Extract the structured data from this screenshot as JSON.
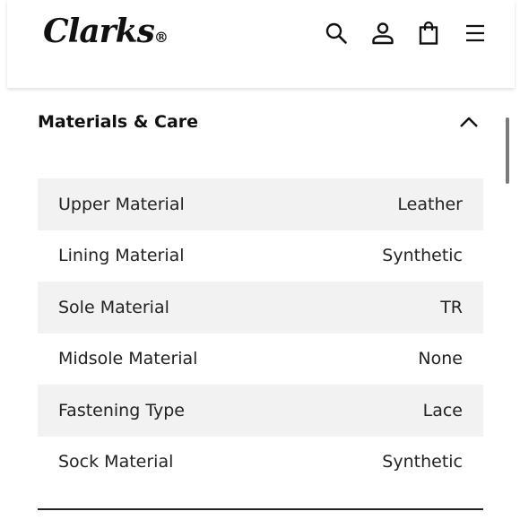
{
  "header": {
    "logo_text": "Clarks",
    "logo_mark": "®",
    "icons": [
      "search-icon",
      "account-icon",
      "shopping-bag-icon",
      "menu-icon"
    ]
  },
  "section": {
    "title": "Materials & Care",
    "expanded": true,
    "icon": "chevron-up-icon"
  },
  "materials": [
    {
      "label": "Upper Material",
      "value": "Leather"
    },
    {
      "label": "Lining Material",
      "value": "Synthetic"
    },
    {
      "label": "Sole Material",
      "value": "TR"
    },
    {
      "label": "Midsole Material",
      "value": "None"
    },
    {
      "label": "Fastening Type",
      "value": "Lace"
    },
    {
      "label": "Sock Material",
      "value": "Synthetic"
    }
  ]
}
